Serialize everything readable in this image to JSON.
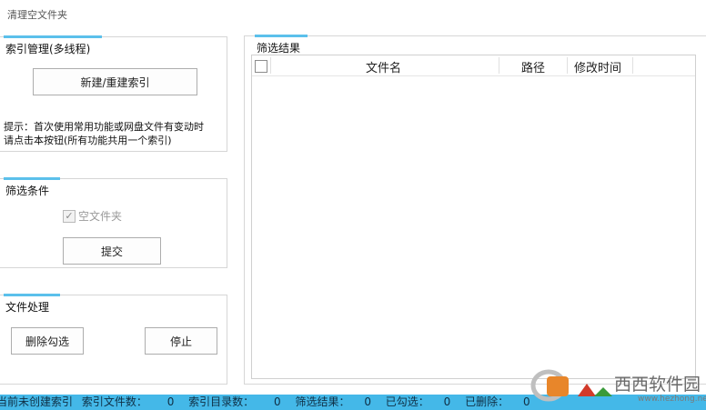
{
  "window": {
    "title": "清理空文件夹"
  },
  "index_panel": {
    "title": "索引管理(多线程)",
    "button_label": "新建/重建索引",
    "hint_line1": "提示：首次使用常用功能或网盘文件有变动时",
    "hint_line2": "请点击本按钮(所有功能共用一个索引)"
  },
  "filter_panel": {
    "title": "筛选条件",
    "checkbox_label": "空文件夹",
    "checkbox_checked": true,
    "submit_label": "提交"
  },
  "file_panel": {
    "title": "文件处理",
    "delete_label": "删除勾选",
    "stop_label": "停止"
  },
  "results_panel": {
    "title": "筛选结果",
    "columns": [
      "文件名",
      "路径",
      "修改时间"
    ]
  },
  "status_bar": {
    "state_text": "当前未创建索引",
    "index_files_label": "索引文件数：",
    "index_files_value": "0",
    "index_dirs_label": "索引目录数：",
    "index_dirs_value": "0",
    "filter_result_label": "筛选结果：",
    "filter_result_value": "0",
    "checked_label": "已勾选：",
    "checked_value": "0",
    "deleted_label": "已删除：",
    "deleted_value": "0"
  },
  "watermark": {
    "brand_text": "西西软件园",
    "url_text": "www.hezhong.net"
  },
  "colors": {
    "accent": "#5bc0eb",
    "status_bar": "#44b8e8"
  }
}
